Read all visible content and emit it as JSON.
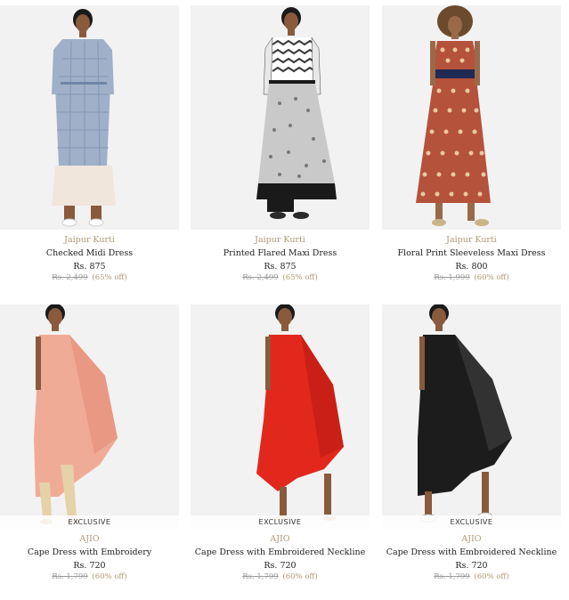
{
  "products": [
    {
      "brand": "Jaipur Kurti",
      "name": "Checked Midi Dress",
      "price": "Rs. 875",
      "mrp": "Rs. 2,499",
      "discount": "(65% off)",
      "badge": "",
      "colors": {
        "dress": "#9fb0c8",
        "pattern": "#6f86a8",
        "pants": "#f1e6dc",
        "skin": "#8a5a3c"
      }
    },
    {
      "brand": "Jaipur Kurti",
      "name": "Printed Flared Maxi Dress",
      "price": "Rs. 875",
      "mrp": "Rs. 2,499",
      "discount": "(65% off)",
      "badge": "",
      "colors": {
        "dress": "#c9c9c9",
        "pattern": "#3a3a3a",
        "pants": "#1a1a1a",
        "skin": "#8a5a3c"
      }
    },
    {
      "brand": "Jaipur Kurti",
      "name": "Floral Print Sleeveless Maxi Dress",
      "price": "Rs. 800",
      "mrp": "Rs. 1,999",
      "discount": "(60% off)",
      "badge": "",
      "colors": {
        "dress": "#b5523b",
        "pattern": "#e8c9a0",
        "pants": "#1f2a55",
        "skin": "#9a6a48"
      }
    },
    {
      "brand": "AJIO",
      "name": "Cape Dress with Embroidery",
      "price": "Rs. 720",
      "mrp": "Rs. 1,799",
      "discount": "(60% off)",
      "badge": "EXCLUSIVE",
      "colors": {
        "dress": "#f0a58f",
        "pattern": "#e58e77",
        "pants": "#e6d2a8",
        "skin": "#8a5a3c"
      }
    },
    {
      "brand": "AJIO",
      "name": "Cape Dress with Embroidered Neckline",
      "price": "Rs. 720",
      "mrp": "Rs. 1,799",
      "discount": "(60% off)",
      "badge": "EXCLUSIVE",
      "colors": {
        "dress": "#e2281d",
        "pattern": "#b71810",
        "pants": "#e2281d",
        "skin": "#8a5a3c"
      }
    },
    {
      "brand": "AJIO",
      "name": "Cape Dress with Embroidered Neckline",
      "price": "Rs. 720",
      "mrp": "Rs. 1,799",
      "discount": "(60% off)",
      "badge": "EXCLUSIVE",
      "colors": {
        "dress": "#1c1c1c",
        "pattern": "#3c3c3c",
        "pants": "#1c1c1c",
        "skin": "#8a5a3c"
      }
    }
  ]
}
